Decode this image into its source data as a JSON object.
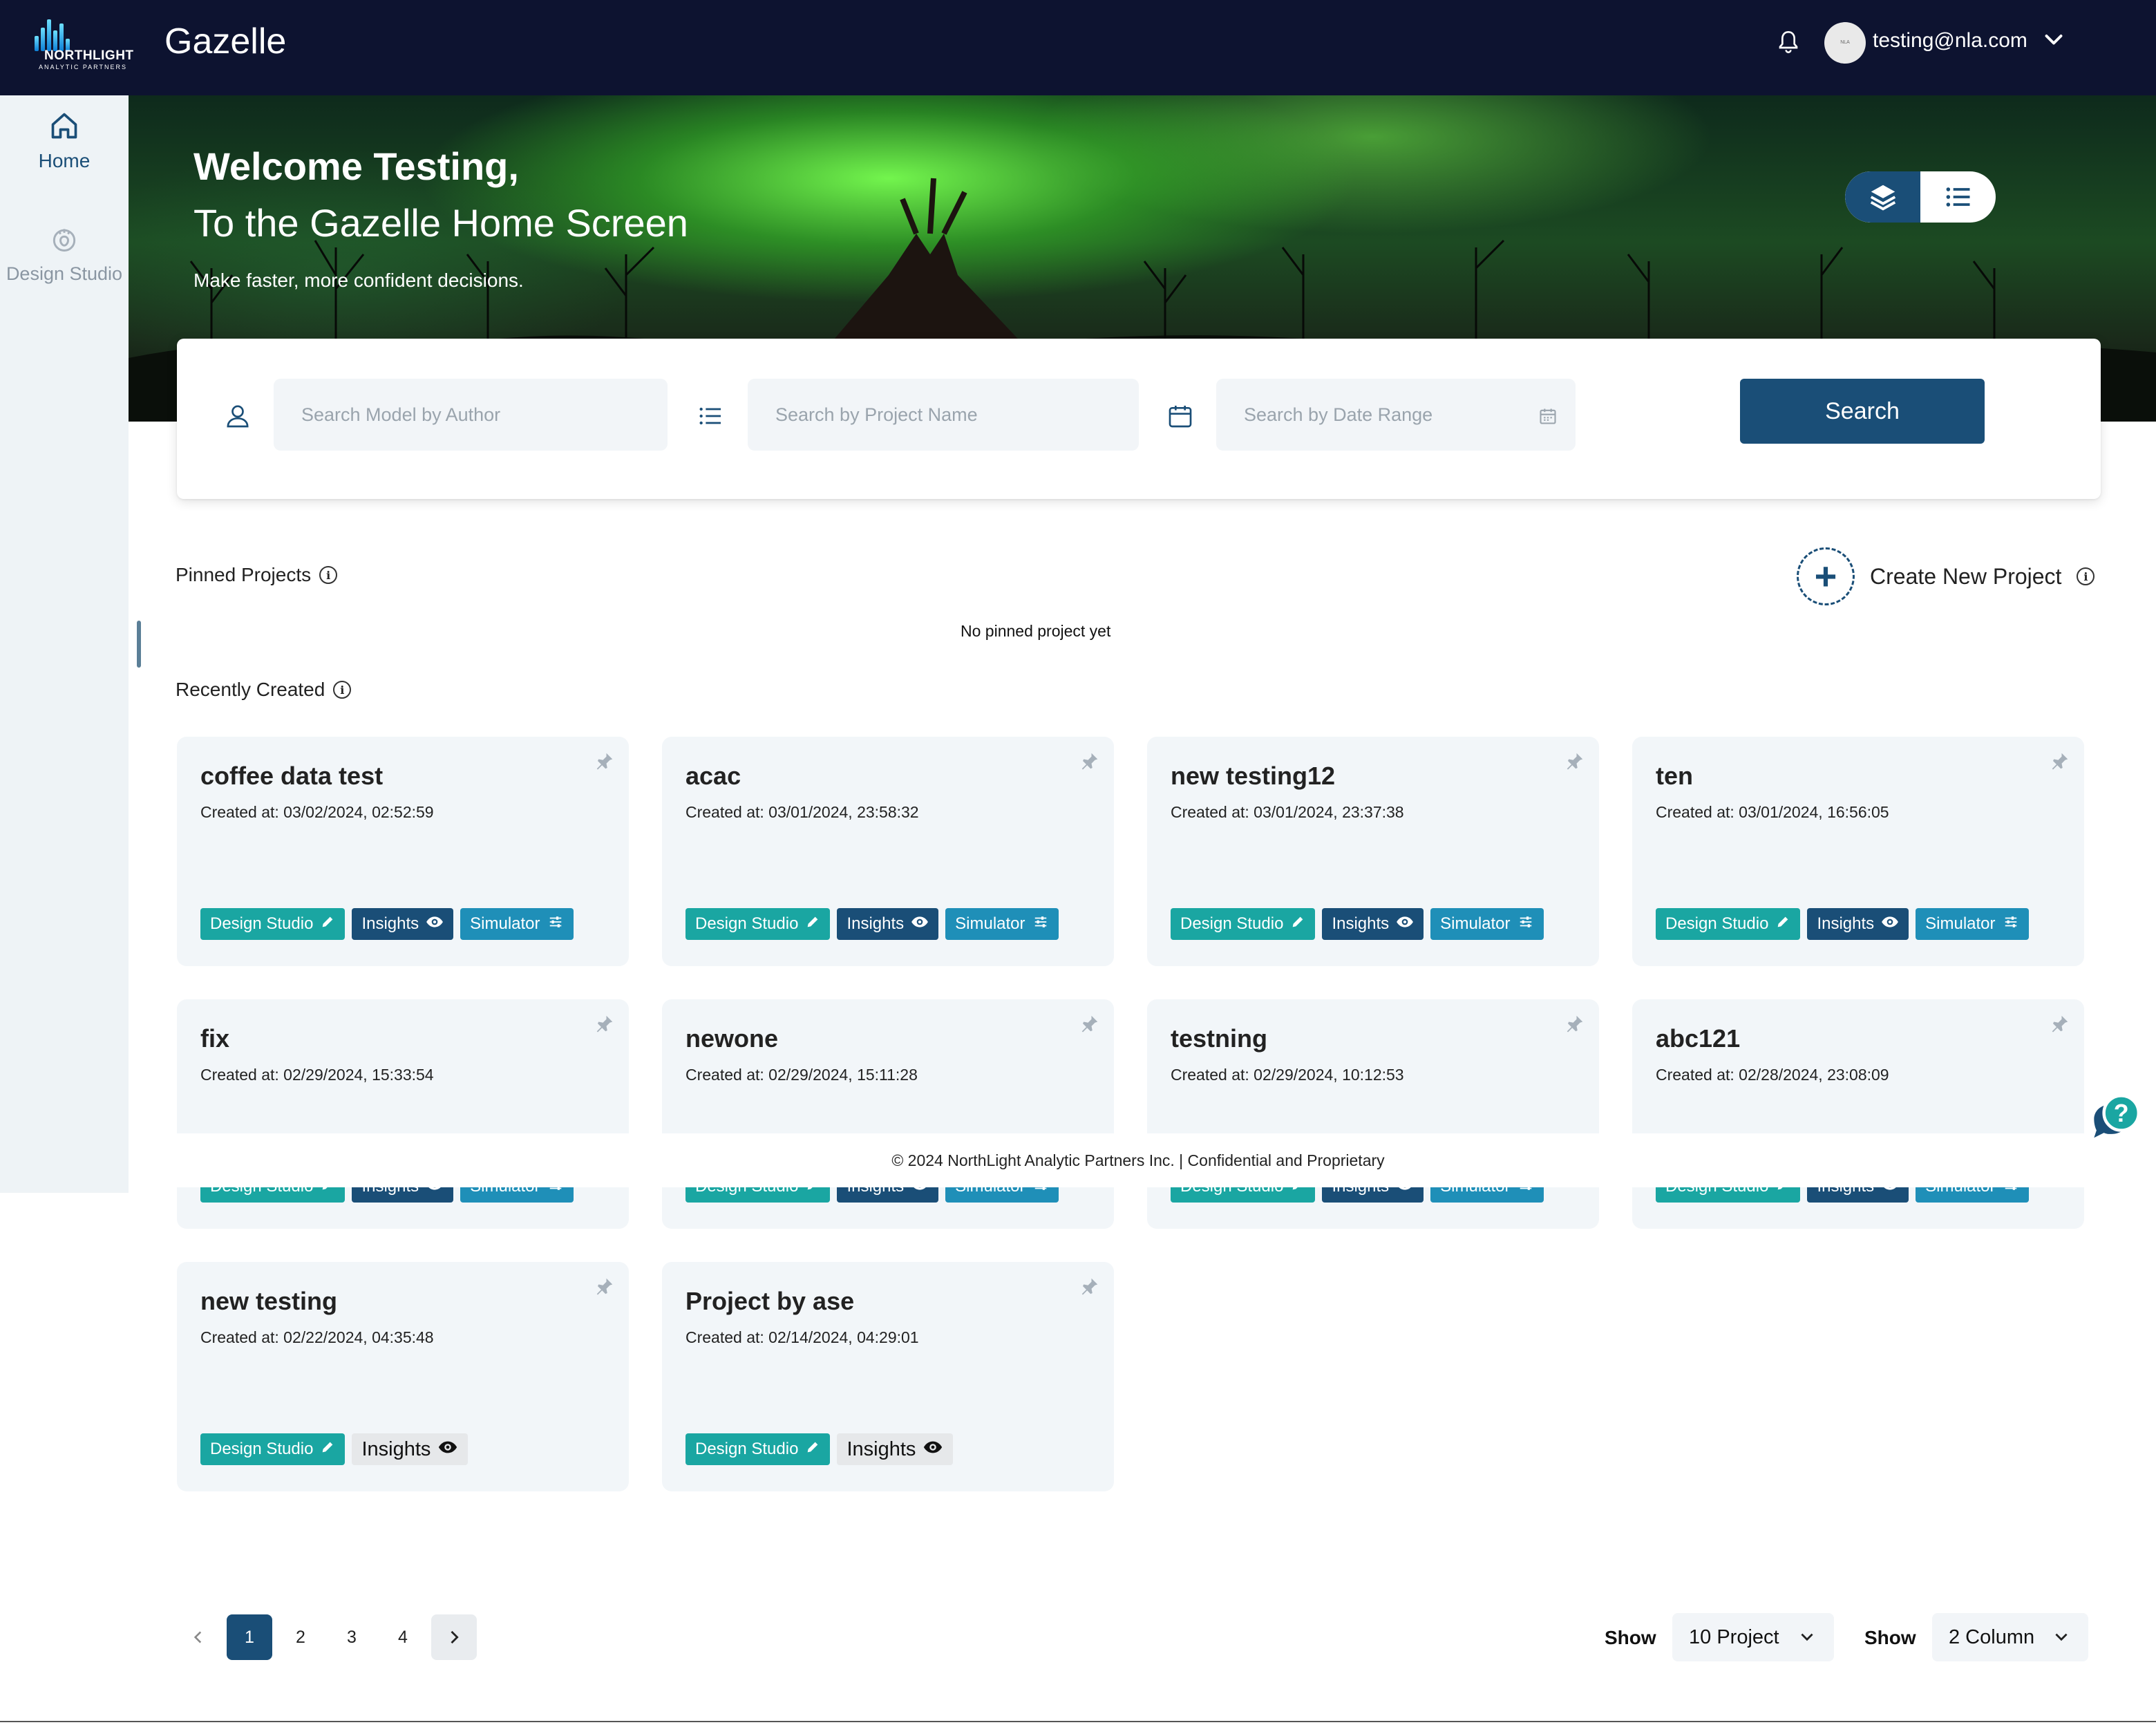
{
  "header": {
    "logo_name": "NORTHLIGHT",
    "logo_sub": "ANALYTIC PARTNERS",
    "app_title": "Gazelle",
    "user_email": "testing@nla.com",
    "avatar_text": "NLA"
  },
  "sidebar": {
    "items": [
      {
        "label": "Home",
        "icon": "home-icon",
        "active": true
      },
      {
        "label": "Design Studio",
        "icon": "design-studio-icon",
        "active": false
      }
    ]
  },
  "hero": {
    "title": "Welcome Testing,",
    "subtitle": "To the Gazelle Home Screen",
    "tagline": "Make faster, more confident decisions."
  },
  "search": {
    "author_placeholder": "Search Model by Author",
    "project_placeholder": "Search by Project Name",
    "date_placeholder": "Search by Date Range",
    "button_label": "Search"
  },
  "pinned": {
    "title": "Pinned Projects",
    "empty_text": "No pinned project yet",
    "create_label": "Create New Project"
  },
  "recent": {
    "title": "Recently Created",
    "projects": [
      {
        "name": "coffee data test",
        "created": "Created at: 03/02/2024, 02:52:59"
      },
      {
        "name": "acac",
        "created": "Created at: 03/01/2024, 23:58:32"
      },
      {
        "name": "new testing12",
        "created": "Created at: 03/01/2024, 23:37:38"
      },
      {
        "name": "ten",
        "created": "Created at: 03/01/2024, 16:56:05"
      },
      {
        "name": "fix",
        "created": "Created at: 02/29/2024, 15:33:54"
      },
      {
        "name": "newone",
        "created": "Created at: 02/29/2024, 15:11:28"
      },
      {
        "name": "testning",
        "created": "Created at: 02/29/2024, 10:12:53"
      },
      {
        "name": "abc121",
        "created": "Created at: 02/28/2024, 23:08:09"
      },
      {
        "name": "new testing",
        "created": "Created at: 02/22/2024, 04:35:48"
      },
      {
        "name": "Project by ase",
        "created": "Created at: 02/14/2024, 04:29:01"
      }
    ],
    "tags": {
      "design_studio": "Design Studio",
      "insights": "Insights",
      "simulator": "Simulator"
    }
  },
  "footer": {
    "copyright": "© 2024 NorthLight Analytic Partners Inc. | Confidential and Proprietary"
  },
  "pagination": {
    "pages": [
      "1",
      "2",
      "3",
      "4"
    ],
    "current": "1",
    "show_label": "Show",
    "per_page": "10 Project",
    "columns": "2 Column"
  },
  "colors": {
    "header_bg": "#0d1330",
    "primary": "#1a4e77",
    "teal": "#1aa6a2",
    "sim_blue": "#1f8fb8",
    "card_bg": "#f2f6f9"
  }
}
